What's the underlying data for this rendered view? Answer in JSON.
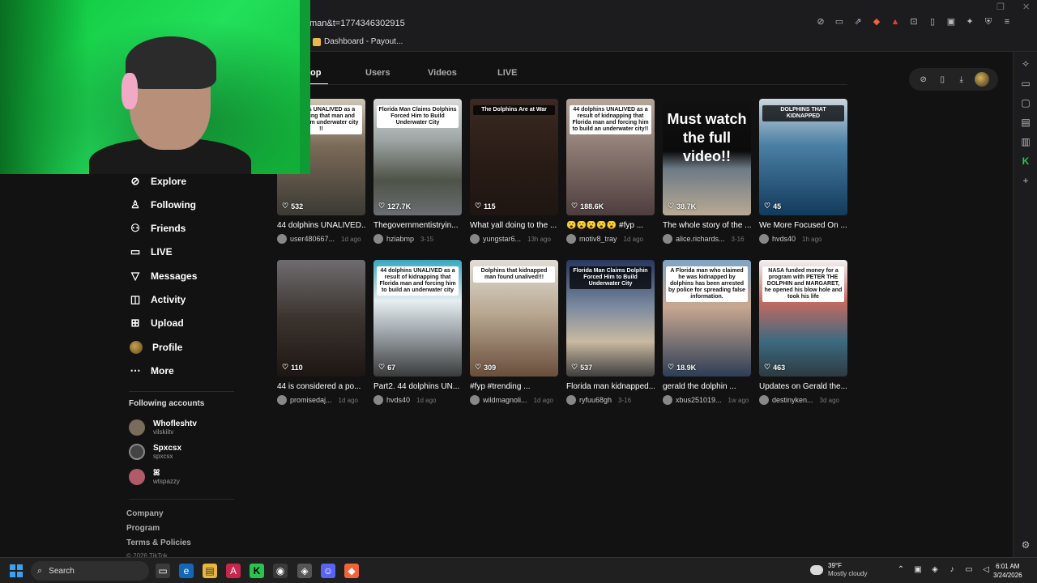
{
  "browser": {
    "url_fragment": "man&t=1774346302915",
    "bookmark": "Dashboard - Payout...",
    "brave_badge": "1"
  },
  "search_tabs": {
    "active_partial": "op",
    "users": "Users",
    "videos": "Videos",
    "live": "LIVE"
  },
  "nav": {
    "items": [
      {
        "label": "Explore",
        "icon": "compass-icon"
      },
      {
        "label": "Following",
        "icon": "following-icon"
      },
      {
        "label": "Friends",
        "icon": "friends-icon"
      },
      {
        "label": "LIVE",
        "icon": "live-icon"
      },
      {
        "label": "Messages",
        "icon": "messages-icon"
      },
      {
        "label": "Activity",
        "icon": "activity-icon"
      },
      {
        "label": "Upload",
        "icon": "upload-icon"
      },
      {
        "label": "Profile",
        "icon": "profile-icon"
      },
      {
        "label": "More",
        "icon": "more-icon"
      }
    ],
    "following_title": "Following accounts",
    "accounts": [
      {
        "name": "Whofleshtv",
        "handle": "vilskiitv"
      },
      {
        "name": "Spxcsx",
        "handle": "spxcsx"
      },
      {
        "name": "ꕤ",
        "handle": "wtspazzy"
      }
    ],
    "footer": [
      "Company",
      "Program",
      "Terms & Policies"
    ],
    "copyright": "© 2026 TikTok"
  },
  "videos": [
    {
      "title": "44 dolphins UNALIVED...",
      "user": "user480667...",
      "date": "1d ago",
      "likes": "532",
      "caption": "Dolphins UNALIVED as a kidnapping that man and forcing him underwater city !!",
      "caption_style": "light",
      "theme": "t-crowd"
    },
    {
      "title": "Thegovernmentistryin...",
      "user": "hziabmp",
      "date": "3-15",
      "likes": "127.7K",
      "caption": "Florida Man Claims Dolphins Forced Him to Build Underwater City",
      "caption_style": "light",
      "theme": "t-beach"
    },
    {
      "title": "What yall doing to the ...",
      "user": "yungstar6...",
      "date": "13h ago",
      "likes": "115",
      "caption": "The Dolphins Are at War",
      "caption_style": "dark",
      "theme": "t-dark"
    },
    {
      "title": "😮😮😮😮😮 #fyp ...",
      "user": "motiv8_tray",
      "date": "1d ago",
      "likes": "188.6K",
      "caption": "44 dolphins UNALIVED as a result of kidnapping that Florida man and forcing him to build an underwater city!!",
      "caption_style": "light",
      "theme": "t-face"
    },
    {
      "title": "The whole story of the ...",
      "user": "alice.richards...",
      "date": "3-16",
      "likes": "38.7K",
      "caption": "Must watch the full video!!",
      "caption_style": "big",
      "theme": "t-must"
    },
    {
      "title": "We More Focused On ...",
      "user": "hvds40",
      "date": "1h ago",
      "likes": "45",
      "caption": "DOLPHINS THAT KIDNAPPED",
      "caption_style": "dark",
      "theme": "t-whale"
    },
    {
      "title": "44 is considered a po...",
      "user": "promisedaj...",
      "date": "1d ago",
      "likes": "110",
      "caption": "",
      "caption_style": "none",
      "theme": "t-room"
    },
    {
      "title": "Part2. 44 dolphins UN...",
      "user": "hvds40",
      "date": "1d ago",
      "likes": "67",
      "caption": "44 dolphins UNALIVED as a result of kidnapping that Florida man and forcing him to build an underwater city",
      "caption_style": "light",
      "theme": "t-aerial"
    },
    {
      "title": "#fyp #trending ...",
      "user": "wildmagnoli...",
      "date": "1d ago",
      "likes": "309",
      "caption": "Dolphins that kidnapped man found unalived!!!",
      "caption_style": "light",
      "theme": "t-beige"
    },
    {
      "title": "Florida man kidnapped...",
      "user": "ryfuu68gh",
      "date": "3-16",
      "likes": "537",
      "caption": "Florida Man Claims Dolphin Forced Him to Build Underwater City",
      "caption_style": "dark",
      "theme": "t-rescue"
    },
    {
      "title": "gerald the dolphin ...",
      "user": "xbus251019...",
      "date": "1w ago",
      "likes": "18.9K",
      "caption": "A Florida man who claimed he was kidnapped by dolphins has been arrested by police for spreading false information.",
      "caption_style": "light",
      "theme": "t-news"
    },
    {
      "title": "Updates on Gerald the...",
      "user": "destinyken...",
      "date": "3d ago",
      "likes": "463",
      "caption": "NASA funded money for a program with PETER THE DOLPHIN and MARGARET, he opened his blow hole and took his life",
      "caption_style": "light",
      "theme": "t-red"
    }
  ],
  "taskbar": {
    "search": "Search",
    "temp": "39°F",
    "weather": "Mostly cloudy",
    "time": "6:01 AM",
    "date": "3/24/2026",
    "notif_badge": "99+"
  }
}
